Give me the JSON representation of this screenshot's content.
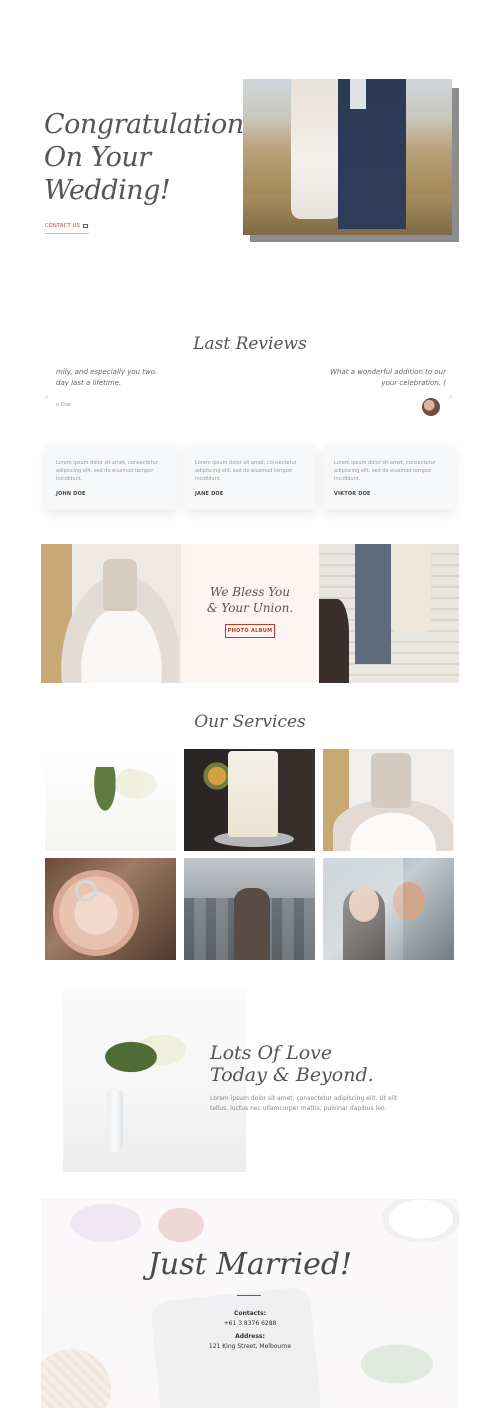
{
  "hero": {
    "title_lines": [
      "Congratulations",
      "On Your",
      "Wedding!"
    ],
    "contact_label": "CONTACT US"
  },
  "reviews": {
    "title": "Last Reviews",
    "left_quote": "mily, and especially you two. day last a lifetime.",
    "left_name": "n Doe",
    "right_quote": "What a wonderful addition to our your celebration. (",
    "cards": [
      {
        "text": "Lorem ipsum dolor sit amet, consectetur adipiscing elit, sed do eiusmod tempor incididunt.",
        "name": "JOHN DOE"
      },
      {
        "text": "Lorem ipsum dolor sit amet, consectetur adipiscing elit, sed do eiusmod tempor incididunt.",
        "name": "JANE DOE"
      },
      {
        "text": "Lorem ipsum dolor sit amet, consectetur adipiscing elit, sed do eiusmod tempor incididunt.",
        "name": "VIKTOR DOE"
      }
    ]
  },
  "bless": {
    "title_line1": "We Bless You",
    "title_line2": "& Your Union.",
    "button": "PHOTO ALBUM"
  },
  "services": {
    "title": "Our Services"
  },
  "love": {
    "title_line1": "Lots Of Love",
    "title_line2": "Today & Beyond.",
    "text": "Lorem ipsum dolor sit amet, consectetur adipiscing elit. Ut elit tellus, luctus nec ullamcorper mattis, pulvinar dapibus leo."
  },
  "footer": {
    "title": "Just Married!",
    "contacts_label": "Contacts:",
    "phone": "+61 3 8376 6288",
    "address_label": "Address:",
    "address": "121 King Street, Melbourne"
  },
  "colors": {
    "accent": "#c0392b",
    "text": "#555555",
    "card_bg": "#f6f7f9",
    "bless_bg": "#fff4f2"
  }
}
